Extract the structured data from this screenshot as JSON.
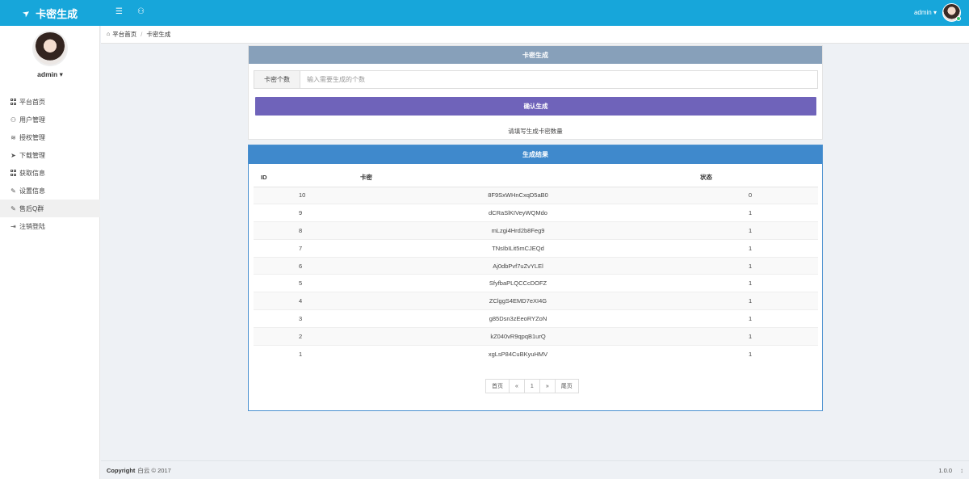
{
  "brand": {
    "title": "卡密生成",
    "icon": "rocket-icon"
  },
  "header": {
    "menu_icon": "list-icon",
    "user_icon": "user-icon",
    "username": "admin",
    "caret": "▾"
  },
  "sidebar": {
    "username": "admin",
    "caret": "▾",
    "items": [
      {
        "label": "平台首页",
        "icon": "grid-icon",
        "active": false
      },
      {
        "label": "用户管理",
        "icon": "user-icon",
        "active": false
      },
      {
        "label": "授权管理",
        "icon": "layers-icon",
        "active": false
      },
      {
        "label": "下载管理",
        "icon": "rocket-icon",
        "active": false
      },
      {
        "label": "获取信息",
        "icon": "grid-icon",
        "active": false
      },
      {
        "label": "设置信息",
        "icon": "edit-icon",
        "active": false
      },
      {
        "label": "售后Q群",
        "icon": "edit-icon",
        "active": true
      },
      {
        "label": "注销登陆",
        "icon": "logout-icon",
        "active": false
      }
    ]
  },
  "breadcrumb": {
    "home": "平台首页",
    "current": "卡密生成"
  },
  "generate_panel": {
    "title": "卡密生成",
    "input_label": "卡密个数",
    "input_placeholder": "输入需要生成的个数",
    "input_value": "",
    "button": "确认生成",
    "hint": "请填写生成卡密数量"
  },
  "result_panel": {
    "title": "生成结果",
    "columns": [
      "ID",
      "卡密",
      "状态"
    ],
    "rows": [
      [
        "10",
        "8F9SxWHnCxqD5aB0",
        "0"
      ],
      [
        "9",
        "dCRaSlKIVeyWQMdo",
        "1"
      ],
      [
        "8",
        "mLzgi4Hrd2b8Feg9",
        "1"
      ],
      [
        "7",
        "TNsIbILit5mCJEQd",
        "1"
      ],
      [
        "6",
        "Aj0dbPvf7uZvYLEl",
        "1"
      ],
      [
        "5",
        "SfyfbaPLQCCcDOFZ",
        "1"
      ],
      [
        "4",
        "ZClggS4EMD7eXI4G",
        "1"
      ],
      [
        "3",
        "g85Dsn3zEeoRYZoN",
        "1"
      ],
      [
        "2",
        "kZ040vR9qpqB1urQ",
        "1"
      ],
      [
        "1",
        "xgLsP84CuBKyuHMV",
        "1"
      ]
    ],
    "pager": [
      "首页",
      "«",
      "1",
      "»",
      "尾页"
    ]
  },
  "footer": {
    "copyright_label": "Copyright",
    "copyright_text": "白云 © 2017",
    "version": "1.0.0",
    "scroll_icon": "↕"
  },
  "colors": {
    "topbar": "#17a6da",
    "panel1_head": "#87a0ba",
    "button": "#6f63ba",
    "panel2_head": "#3f89cc"
  }
}
